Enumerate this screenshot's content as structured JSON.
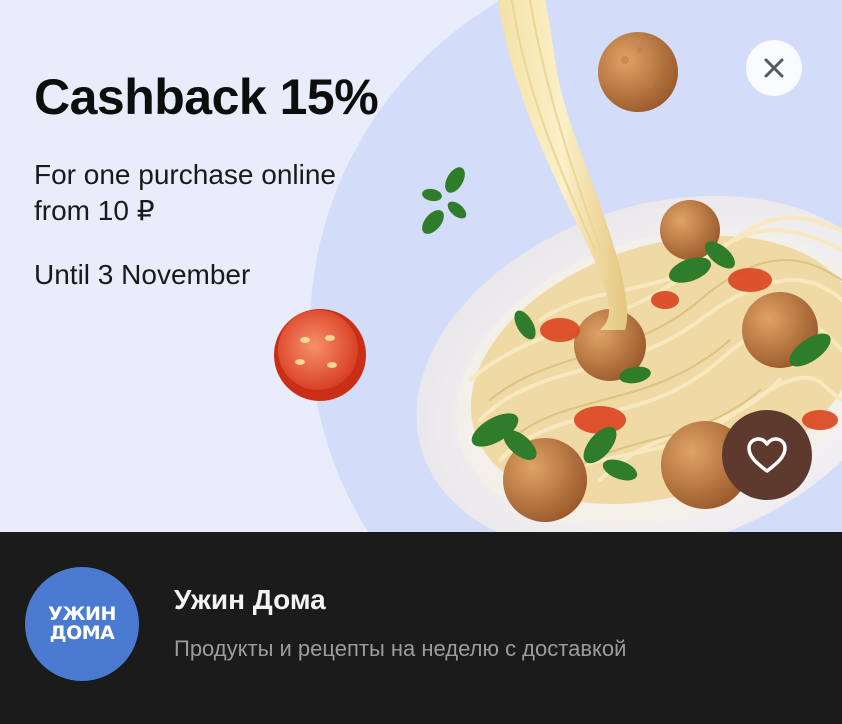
{
  "promo": {
    "headline": "Cashback 15%",
    "line1": "For one purchase online",
    "line2": "from 10 ₽",
    "line3": "Until 3 November",
    "close_icon": "close-icon",
    "favorite_icon": "heart-icon"
  },
  "brand": {
    "logo_line1": "УЖИН",
    "logo_line2": "ДОМА",
    "name": "Ужин Дома",
    "description": "Продукты и рецепты на неделю с доставкой"
  },
  "colors": {
    "banner_bg": "#e8ecfb",
    "footer_bg": "#1b1b1c",
    "logo_bg": "#4a7bd0",
    "favorite_bg": "#5e3a2e"
  }
}
